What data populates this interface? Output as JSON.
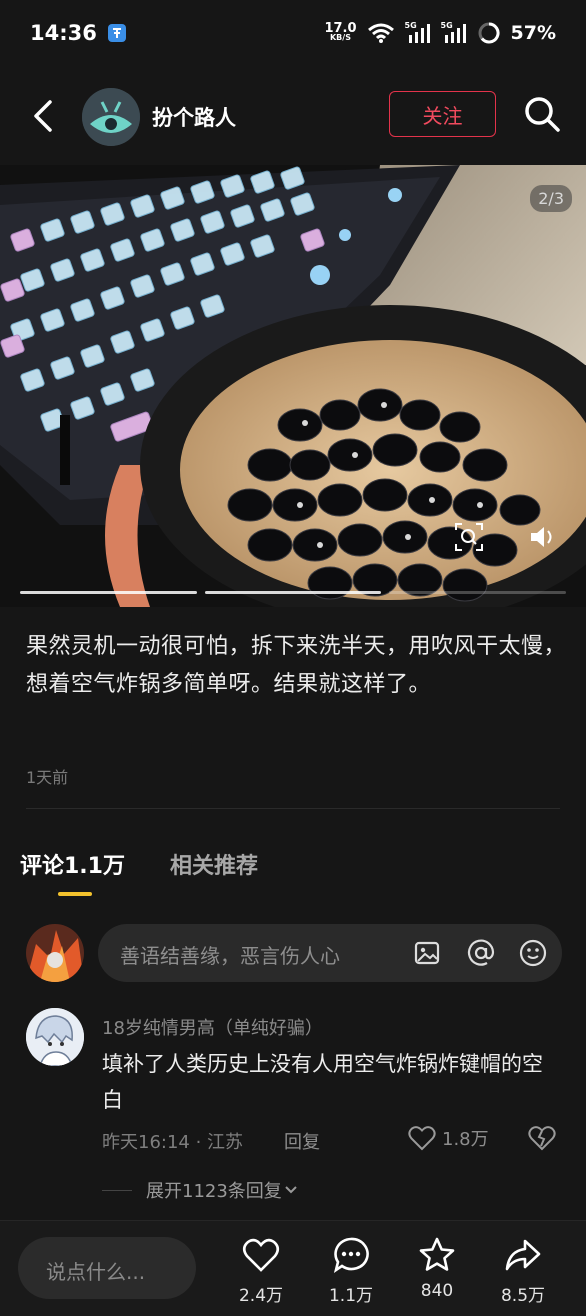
{
  "status_bar": {
    "time": "14:36",
    "net_speed_value": "17.0",
    "net_speed_unit": "KB/S",
    "signal_tag_1": "5G",
    "signal_tag_2": "5G",
    "battery": "57%"
  },
  "header": {
    "author": "扮个路人",
    "follow_label": "关注"
  },
  "media": {
    "page_counter": "2/3",
    "progress_current": 2,
    "progress_total": 3
  },
  "post": {
    "caption": "果然灵机一动很可怕，拆下来洗半天，用吹风干太慢，想着空气炸锅多简单呀。结果就这样了。",
    "time": "1天前"
  },
  "tabs": {
    "comments": "评论1.1万",
    "related": "相关推荐"
  },
  "comment_input": {
    "placeholder": "善语结善缘，恶言伤人心"
  },
  "comment": {
    "user": "18岁纯情男高（单纯好骗）",
    "text": "填补了人类历史上没有人用空气炸锅炸键帽的空白",
    "meta": "昨天16:14 · 江苏",
    "reply": "回复",
    "likes": "1.8万",
    "expand": "展开1123条回复"
  },
  "bottom_bar": {
    "placeholder": "说点什么...",
    "likes": "2.4万",
    "comments": "1.1万",
    "favorites": "840",
    "shares": "8.5万"
  },
  "colors": {
    "accent_follow": "#e3334b",
    "tab_underline": "#f3c22d",
    "background": "#161616"
  }
}
